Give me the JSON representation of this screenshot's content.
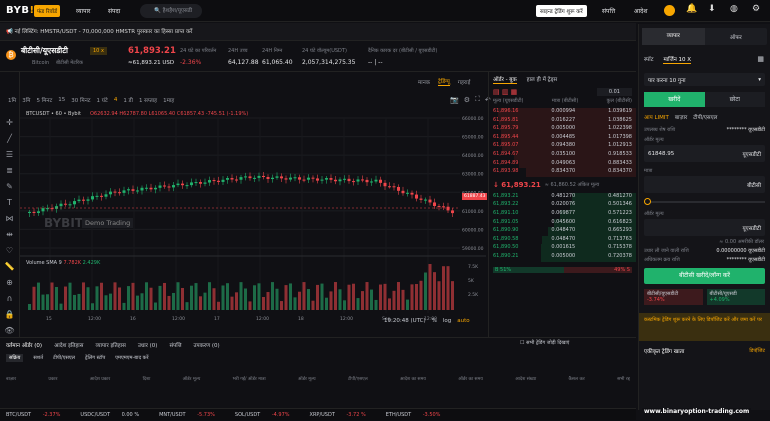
{
  "nav": {
    "logo_main": "BYB",
    "logo_accent": "!T",
    "badge": "फंड रिवॉर्ड",
    "items": [
      "व्यापार",
      "संपदा"
    ],
    "search_placeholder": "🔍 हैशहैश/यूएसडी",
    "trade_button": "साइन्ड ट्रेडिंग शुरू करें",
    "right_items": [
      "संपत्ति",
      "आदेश"
    ]
  },
  "ticker": {
    "text": "नई लिस्टिंग: HMSTR/USDT - 70,000,000 HMSTR पुरस्कार का हिस्सा प्राप्त करें"
  },
  "pair": {
    "name": "बीटीसी/यूएसडीटी",
    "leverage": "10 x",
    "sub1": "Bitcoin",
    "sub2": "बीटीसी मेटरिक",
    "price": "61,893.21",
    "price_usd": "≈61,893.21 USD",
    "stats": [
      {
        "l": "24 घंटे का परिवर्तन",
        "v": "-2.36%",
        "c": "red"
      },
      {
        "l": "24H उच्च",
        "v": "64,127.88"
      },
      {
        "l": "24H निम्न",
        "v": "61,065.40"
      },
      {
        "l": "24 घंटे वॉल्यूम(USDT)",
        "v": "2,057,314,275.35"
      },
      {
        "l": "दैनिक कारक दर (बीटीसी / यूएसडीटी)",
        "v": "-- | --"
      }
    ]
  },
  "chart": {
    "timeframes": [
      "1मि",
      "3मि",
      "5 मिनट",
      "15",
      "30 मिनट",
      "1 घंटे",
      "4",
      "1 डी",
      "1 सप्ताह",
      "1माह"
    ],
    "views": [
      "मानक",
      "ट्रेडिंग्यू",
      "गहराई"
    ],
    "symbol": "BTCUSDT • 60 • Bybit",
    "ohlc": "O62632.94 H62787.80 L61065.40 C61857.43 -745.51 (-1.19%)",
    "watermark": "BYBIT",
    "demo": "Demo Trading",
    "volume_label": "Volume SMA 9",
    "vol1": "7.782K",
    "vol2": "2.429K",
    "time": "19:20:48 (UTC)",
    "pct": "%",
    "log": "log",
    "auto": "auto",
    "last_price_tag": "61887.43"
  },
  "chart_data": {
    "type": "candlestick",
    "price_ticks": [
      "66000.00",
      "65000.00",
      "64000.00",
      "63000.00",
      "62000.00",
      "61000.00",
      "60000.00",
      "59000.00"
    ],
    "time_ticks": [
      "15",
      "12:00",
      "16",
      "12:00",
      "17",
      "12:00",
      "18",
      "12:00",
      "Sep",
      "12:00"
    ],
    "vol_ticks": [
      "7.5K",
      "5K",
      "2.5K"
    ]
  },
  "ob": {
    "tabs": [
      "ऑर्डर - बुक",
      "हाल ही में ट्रेड्स"
    ],
    "precision": "0.01",
    "headers": [
      "मूल्य (यूएसडीटी)",
      "मात्रा (बीटीसी)",
      "कुल (बीटीसी)"
    ],
    "asks": [
      [
        "61,896.16",
        "0.000994",
        "1.039619"
      ],
      [
        "61,895.81",
        "0.016227",
        "1.038625"
      ],
      [
        "61,895.79",
        "0.005000",
        "1.022398"
      ],
      [
        "61,895.44",
        "0.004485",
        "1.017398"
      ],
      [
        "61,895.07",
        "0.094380",
        "1.012913"
      ],
      [
        "61,894.67",
        "0.035100",
        "0.918533"
      ],
      [
        "61,894.89",
        "0.049063",
        "0.883433"
      ],
      [
        "61,893.98",
        "0.834370",
        "0.834370"
      ]
    ],
    "mid": "↓ 61,893.21",
    "mid_sub": "≈ 61,860.52 अंकित मूल्य",
    "bids": [
      [
        "61,893.21",
        "0.481270",
        "0.481270"
      ],
      [
        "61,893.22",
        "0.020076",
        "0.501346"
      ],
      [
        "61,891.10",
        "0.069877",
        "0.571223"
      ],
      [
        "61,891.05",
        "0.045600",
        "0.616823"
      ],
      [
        "61,890.90",
        "0.048470",
        "0.665293"
      ],
      [
        "61,890.58",
        "0.048470",
        "0.713763"
      ],
      [
        "61,890.50",
        "0.001615",
        "0.715378"
      ],
      [
        "61,890.21",
        "0.005000",
        "0.720378"
      ]
    ],
    "buy_pct": "B 51%",
    "sell_pct": "49% S"
  },
  "bottom": {
    "tabs": [
      "वर्तमान ऑर्डर (0)",
      "आदेश इतिहास",
      "व्यापार इतिहास",
      "उधार (0)",
      "संपत्ति",
      "उपकरण (0)"
    ],
    "show_all": "सभी ट्रेडिंग जोड़ी दिखाएं",
    "subtabs": [
      "सक्रिय",
      "सशर्त",
      "टीपी/एसएल",
      "ट्रेलिंग स्टॉप",
      "एमएमएम-बाद करें"
    ],
    "cols": [
      "बाज़ार",
      "प्रकार",
      "आदेश प्रकार",
      "दिशा",
      "ऑर्डर मूल्य",
      "भरी गई/ ऑर्डर मात्रा",
      "ऑर्डर मूल्य",
      "टीपी/एसएल",
      "आदेश का समय",
      "ऑर्डर का समय",
      "आदेश संख्या",
      "कैंसल कर",
      "सभी रद्द"
    ]
  },
  "panel": {
    "tabs": [
      "व्यापार",
      "ऑफर"
    ],
    "modes": [
      "स्पॉट",
      "मार्जिन 10 X"
    ],
    "borrow": "पार करना 10 गुना",
    "buy": "खरीदें",
    "sell": "छोटा",
    "order_types": [
      "आप LIMIT",
      "बाज़ार",
      "टीपी/एसएल"
    ],
    "avail_label": "उपलब्ध शेष राशि",
    "avail_val": "******** यूएसडीटी",
    "price_label": "ऑर्डर मूल्य",
    "price_val": "61848.95",
    "price_unit": "यूएसडीटी",
    "qty_label": "मात्रा",
    "qty_unit": "बीटीसी",
    "value_label": "ऑर्डर मूल्य",
    "value_unit": "यूएसडीटी",
    "est": "≈ 0.00 अमरीकी डॉलर",
    "margin_label": "उधार ली जाने वाली राशि",
    "margin_val": "0.00000000 यूएसडीटी",
    "max_label": "अधिकतम क्रय राशि",
    "max_val": "******** यूएसडीटी",
    "submit": "बीटीसी खरीदें/लॉन्ग करें",
    "buy_mini": "बीटीसी/यूएसडीटी",
    "buy_mini_v": "-3.74%",
    "sell_mini": "बीटीसी/यूएसडी",
    "sell_mini_v": "+4.09%",
    "promo": "कस्टमिक ट्रेडिंग शुरू करने के लिए डिपॉजिट करें और जमा करें पर",
    "acct": "एकीकृत ट्रेडिंग खाता",
    "deposit": "डिपॉ़जिट"
  },
  "status": [
    {
      "s": "BTC/USDT",
      "v": "-2.37%"
    },
    {
      "s": "USDC/USDT",
      "v": "0.00 %"
    },
    {
      "s": "MNT/USDT",
      "v": "-5.73%"
    },
    {
      "s": "SOL/USDT",
      "v": "-4.97%"
    },
    {
      "s": "XRP/USDT",
      "v": "-3.72 %"
    },
    {
      "s": "ETH/USDT",
      "v": "-3.50%"
    }
  ],
  "watermark2": "www.binaryoption-trading.com"
}
